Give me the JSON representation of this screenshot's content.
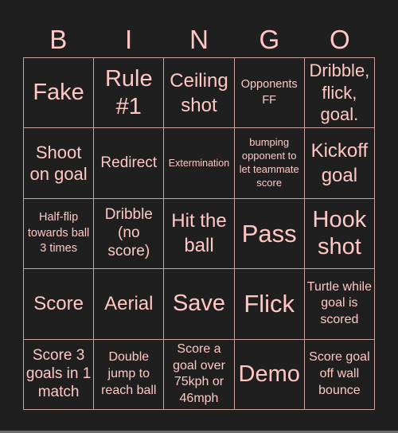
{
  "header": {
    "letters": [
      "B",
      "I",
      "N",
      "G",
      "O"
    ]
  },
  "colors": {
    "background": "#1f1f1f",
    "text": "#ffc8c4",
    "grid_lines": "#c9a3a0"
  },
  "cells": [
    [
      "Fake",
      "Rule #1",
      "Ceiling shot",
      "Opponents FF",
      "Dribble, flick, goal."
    ],
    [
      "Shoot on goal",
      "Redirect",
      "Extermination",
      "bumping opponent to let teammate score",
      "Kickoff goal"
    ],
    [
      "Half-flip towards ball 3 times",
      "Dribble (no score)",
      "Hit the ball",
      "Pass",
      "Hook shot"
    ],
    [
      "Score",
      "Aerial",
      "Save",
      "Flick",
      "Turtle while goal is scored"
    ],
    [
      "Score 3 goals in 1 match",
      "Double jump to reach ball",
      "Score a goal over 75kph or 46mph",
      "Demo",
      "Score goal off wall bounce"
    ]
  ]
}
